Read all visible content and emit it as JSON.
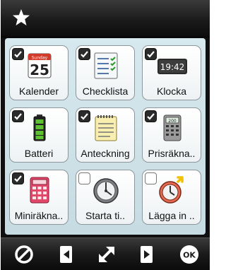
{
  "title_bar": {
    "icon": "star-icon"
  },
  "tiles": [
    {
      "label": "Kalender",
      "checked": true,
      "icon": "calendar-icon",
      "icon_text": "25",
      "icon_top_text": "Sunday"
    },
    {
      "label": "Checklista",
      "checked": true,
      "icon": "checklist-icon"
    },
    {
      "label": "Klocka",
      "checked": true,
      "icon": "clock-icon",
      "icon_text": "19:42"
    },
    {
      "label": "Batteri",
      "checked": true,
      "icon": "battery-icon"
    },
    {
      "label": "Anteckning",
      "checked": true,
      "icon": "notepad-icon"
    },
    {
      "label": "Prisräkna..",
      "checked": true,
      "icon": "price-calculator-icon",
      "icon_text": "200"
    },
    {
      "label": "Miniräkna..",
      "checked": true,
      "icon": "calculator-icon"
    },
    {
      "label": "Starta ti..",
      "checked": false,
      "icon": "timer-icon"
    },
    {
      "label": "Lägga in ..",
      "checked": false,
      "icon": "add-timer-icon"
    }
  ],
  "bottom_bar": [
    {
      "icon": "cancel-icon"
    },
    {
      "icon": "previous-icon"
    },
    {
      "icon": "resize-icon"
    },
    {
      "icon": "next-icon"
    },
    {
      "icon": "ok-icon",
      "label": "OK"
    }
  ],
  "colors": {
    "accent": "#f2c200",
    "title_bar": "#1b1b1b",
    "content_bg": "#cfe3e9"
  }
}
